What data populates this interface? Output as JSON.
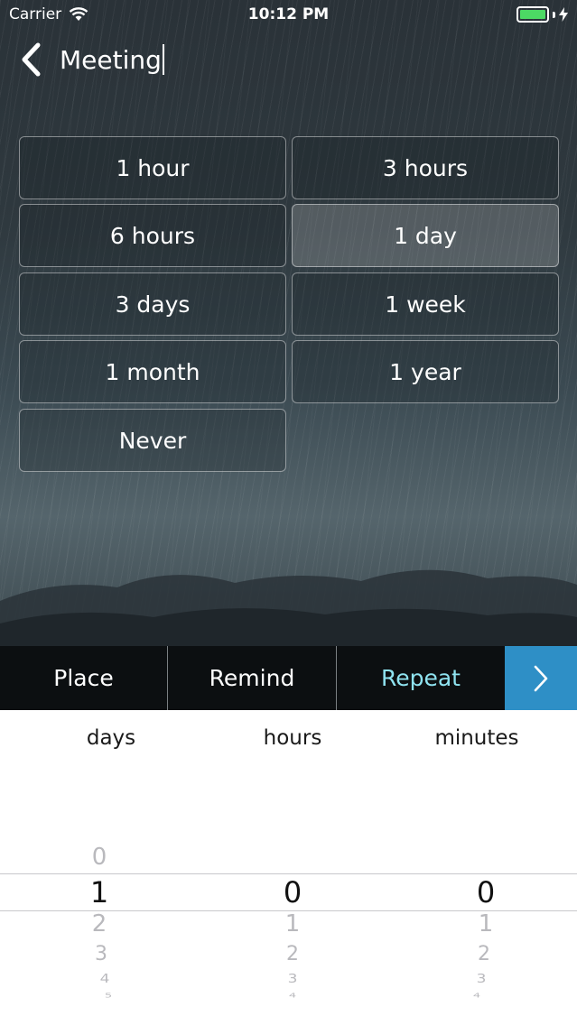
{
  "status": {
    "carrier": "Carrier",
    "time": "10:12 PM"
  },
  "nav": {
    "title_value": "Meeting"
  },
  "options": [
    {
      "label": "1 hour",
      "selected": false
    },
    {
      "label": "3 hours",
      "selected": false
    },
    {
      "label": "6 hours",
      "selected": false
    },
    {
      "label": "1 day",
      "selected": true
    },
    {
      "label": "3 days",
      "selected": false
    },
    {
      "label": "1 week",
      "selected": false
    },
    {
      "label": "1 month",
      "selected": false
    },
    {
      "label": "1 year",
      "selected": false
    },
    {
      "label": "Never",
      "selected": false
    }
  ],
  "tabs": {
    "place": "Place",
    "remind": "Remind",
    "repeat": "Repeat"
  },
  "picker": {
    "days_label": "days",
    "hours_label": "hours",
    "minutes_label": "minutes",
    "days": {
      "above": "0",
      "selected": "1",
      "below": [
        "2",
        "3",
        "4",
        "5"
      ]
    },
    "hours": {
      "selected": "0",
      "below": [
        "1",
        "2",
        "3",
        "4"
      ]
    },
    "minutes": {
      "selected": "0",
      "below": [
        "1",
        "2",
        "3",
        "4"
      ]
    }
  },
  "colors": {
    "accent": "#2e8fc6",
    "active_tab": "#8fe3f0",
    "battery": "#4cd964"
  }
}
